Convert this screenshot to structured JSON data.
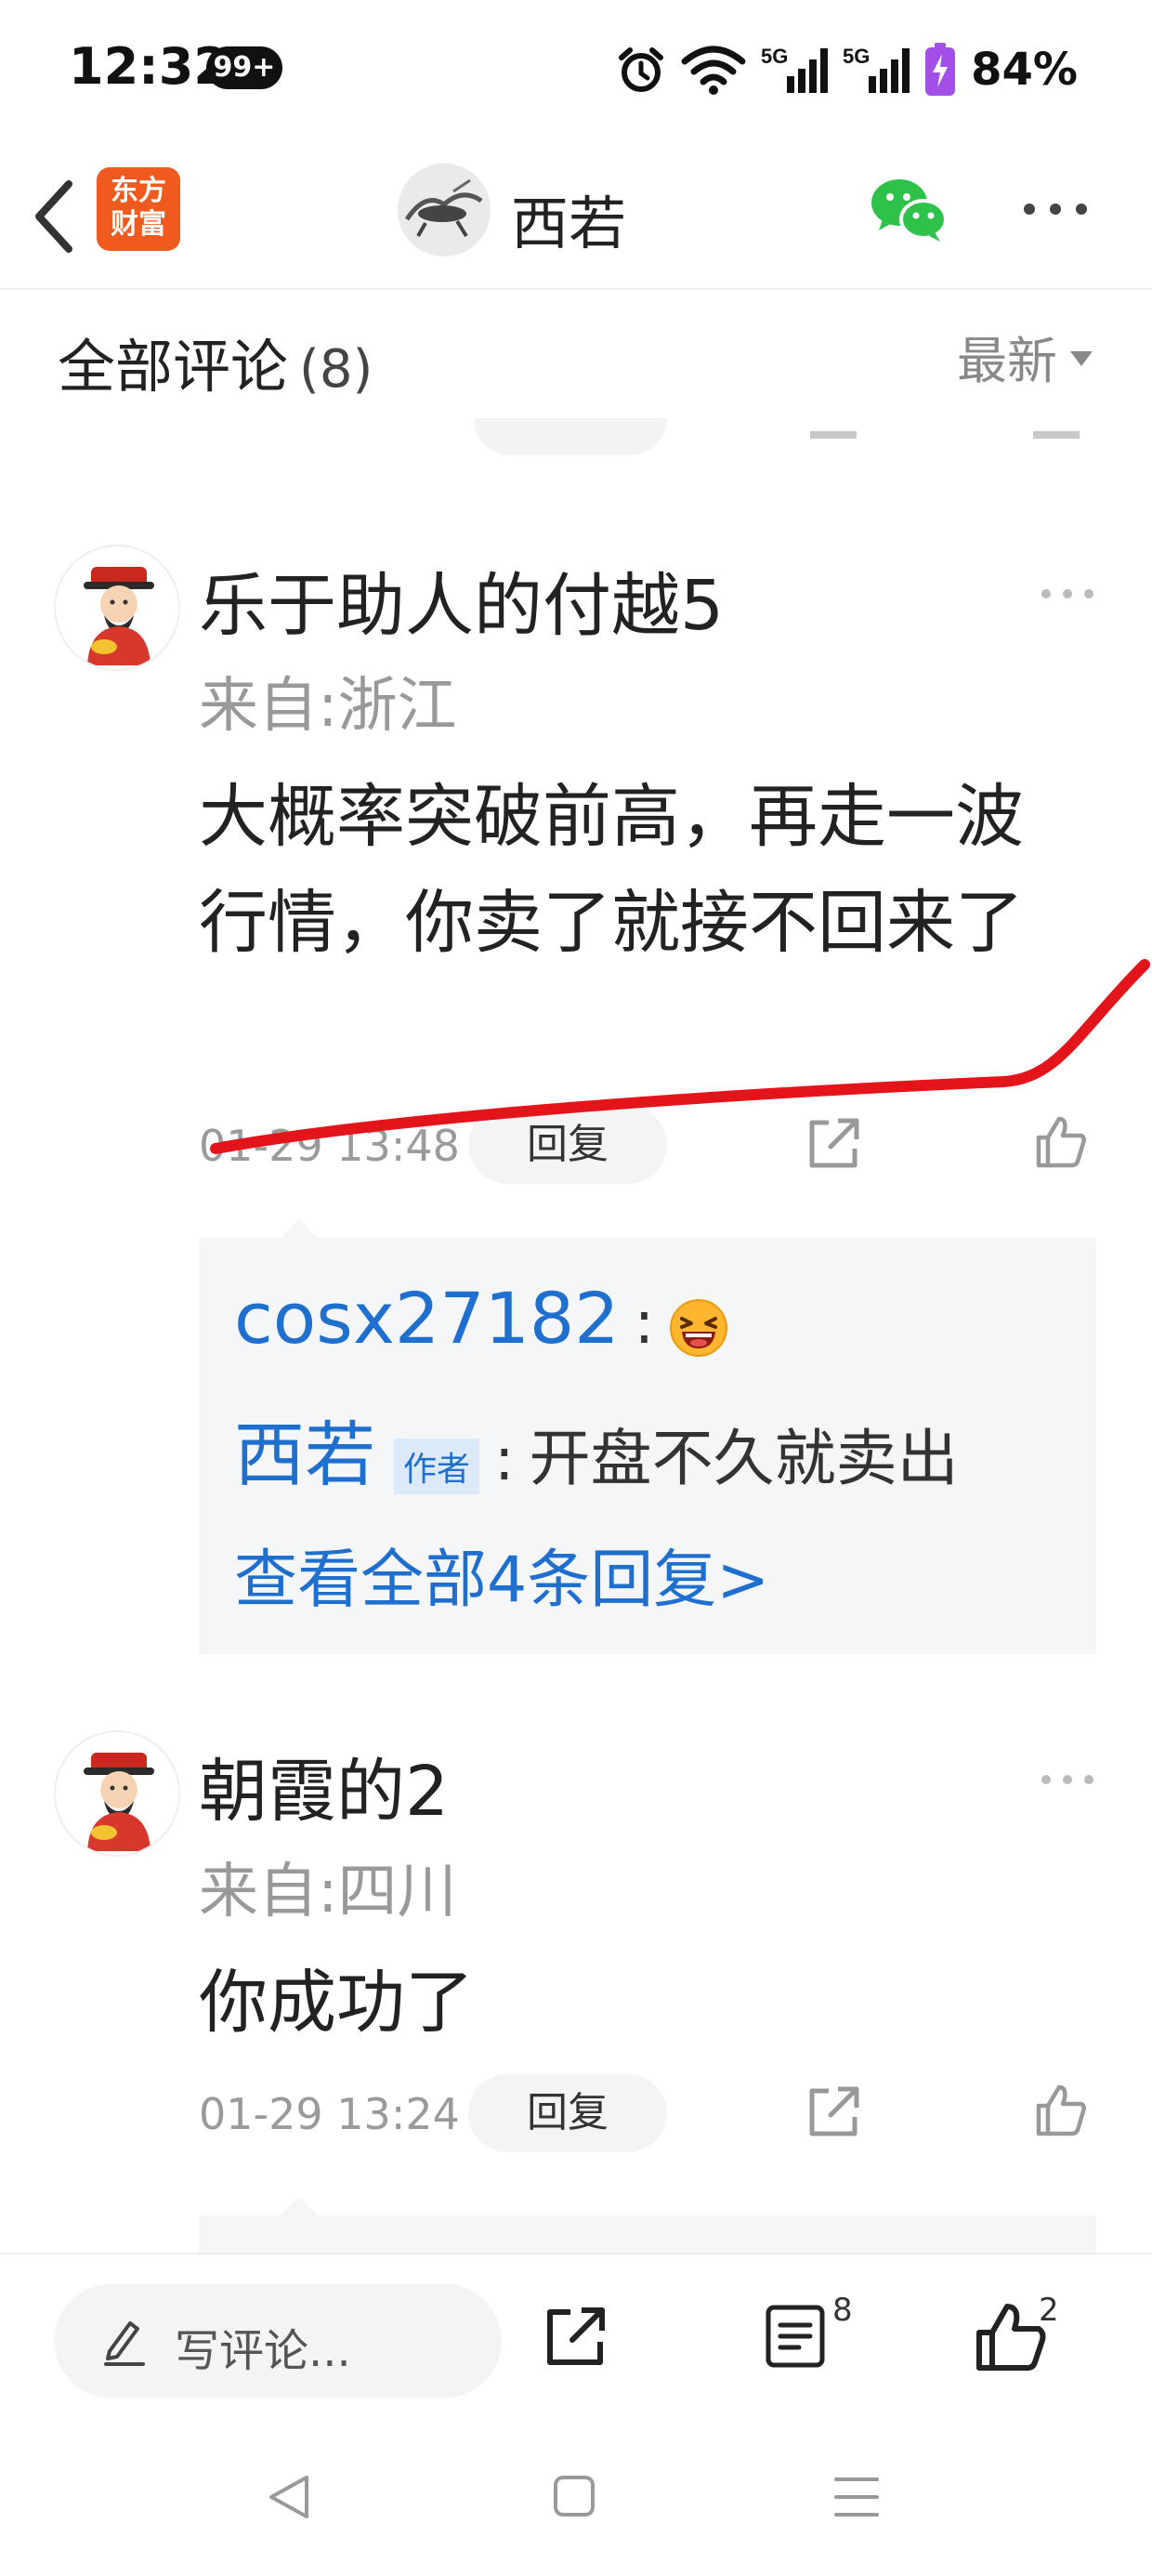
{
  "status_bar": {
    "time": "12:32",
    "notification_badge": "99+",
    "network_1": "5G",
    "network_2": "5G",
    "battery": "84%"
  },
  "nav": {
    "app_logo_line1": "东方",
    "app_logo_line2": "财富",
    "author_name": "西若",
    "icons": [
      "chevron-left-icon",
      "wechat-icon",
      "more-horizontal-icon"
    ]
  },
  "comments_header": {
    "title": "全部评论",
    "count": "(8)",
    "sort_label": "最新"
  },
  "comments": [
    {
      "username": "乐于助人的付越5",
      "location": "来自:浙江",
      "content": "大概率突破前高，再走一波行情，你卖了就接不回来了",
      "time": "01-29 13:48",
      "reply_label": "回复",
      "replies": [
        {
          "user": "cosx27182",
          "colon": ":",
          "text": "",
          "emoji": "laughing-emoji"
        },
        {
          "user": "西若",
          "tag": "作者",
          "colon": ":",
          "text": "开盘不久就卖出"
        }
      ],
      "view_all": "查看全部4条回复>"
    },
    {
      "username": "朝霞的2",
      "location": "来自:四川",
      "content": "你成功了",
      "time": "01-29 13:24",
      "reply_label": "回复"
    }
  ],
  "bottom_bar": {
    "write_placeholder": "写评论...",
    "comment_count": "8",
    "like_count": "2"
  },
  "colors": {
    "link_blue": "#1f6fcf",
    "annotation_red": "#e3151b",
    "logo_orange": "#f05a1e",
    "wechat_green": "#2ec24a"
  }
}
